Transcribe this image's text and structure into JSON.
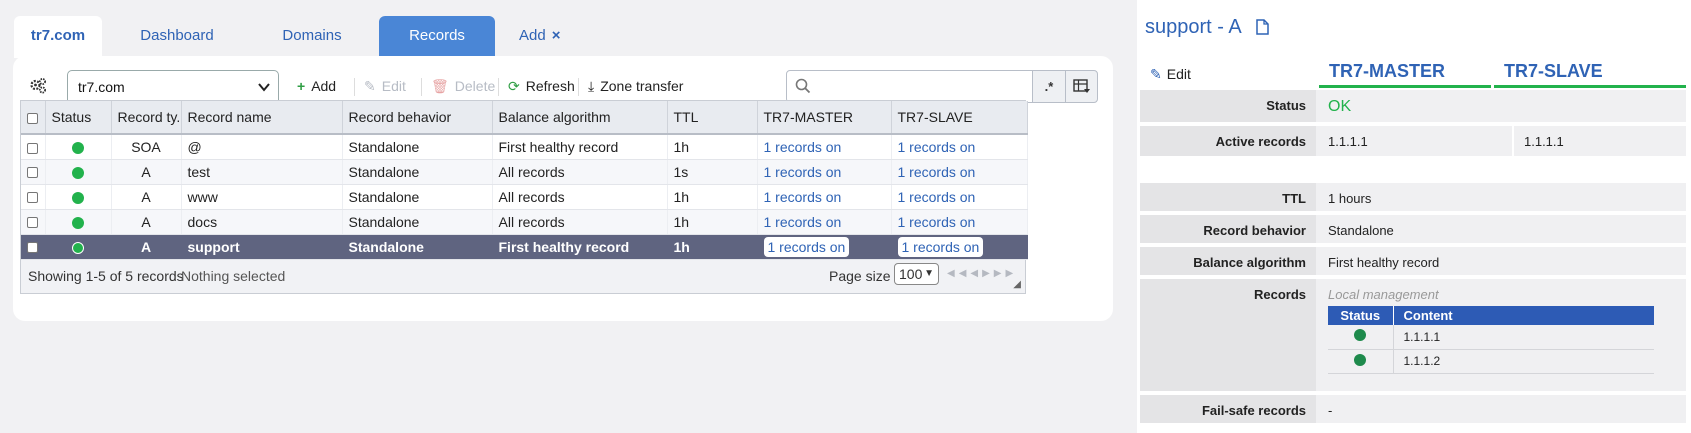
{
  "tabs": {
    "home": "tr7.com",
    "dashboard": "Dashboard",
    "domains": "Domains",
    "records": "Records",
    "add": "Add",
    "add_close": "×"
  },
  "toolbar": {
    "zone_value": "tr7.com",
    "add": "Add",
    "edit": "Edit",
    "delete": "Delete",
    "refresh": "Refresh",
    "zone_transfer": "Zone transfer",
    "search_placeholder": "",
    "regex": ".*"
  },
  "grid": {
    "columns": [
      "Status",
      "Record ty...",
      "Record name",
      "Record behavior",
      "Balance algorithm",
      "TTL",
      "TR7-MASTER",
      "TR7-SLAVE"
    ],
    "rows": [
      {
        "type": "SOA",
        "name": "@",
        "behavior": "Standalone",
        "algorithm": "First healthy record",
        "ttl": "1h",
        "master": "1 records on",
        "slave": "1 records on"
      },
      {
        "type": "A",
        "name": "test",
        "behavior": "Standalone",
        "algorithm": "All records",
        "ttl": "1s",
        "master": "1 records on",
        "slave": "1 records on"
      },
      {
        "type": "A",
        "name": "www",
        "behavior": "Standalone",
        "algorithm": "All records",
        "ttl": "1h",
        "master": "1 records on",
        "slave": "1 records on"
      },
      {
        "type": "A",
        "name": "docs",
        "behavior": "Standalone",
        "algorithm": "All records",
        "ttl": "1h",
        "master": "1 records on",
        "slave": "1 records on"
      },
      {
        "type": "A",
        "name": "support",
        "behavior": "Standalone",
        "algorithm": "First healthy record",
        "ttl": "1h",
        "master": "1 records on",
        "slave": "1 records on"
      }
    ],
    "footer": {
      "showing": "Showing 1-5 of 5 records",
      "selection": "Nothing selected",
      "page_size_label": "Page size :",
      "page_size": "100"
    }
  },
  "detail": {
    "title": "support - A",
    "edit": "Edit",
    "servers": [
      "TR7-MASTER",
      "TR7-SLAVE"
    ],
    "status_label": "Status",
    "status_value": "OK",
    "active_label": "Active records",
    "active_master": "1.1.1.1",
    "active_slave": "1.1.1.1",
    "ttl_label": "TTL",
    "ttl_value": "1 hours",
    "behavior_label": "Record behavior",
    "behavior_value": "Standalone",
    "algorithm_label": "Balance algorithm",
    "algorithm_value": "First healthy record",
    "records_label": "Records",
    "records_note": "Local management",
    "records_table": {
      "headers": [
        "Status",
        "Content"
      ],
      "rows": [
        {
          "content": "1.1.1.1"
        },
        {
          "content": "1.1.1.2"
        }
      ]
    },
    "failsafe_label": "Fail-safe records",
    "failsafe_value": "-"
  },
  "colors": {
    "accent": "#2f63b5",
    "active_tab": "#4a86d6",
    "selected_row": "#5f6480",
    "status_ok": "#22b24c"
  }
}
